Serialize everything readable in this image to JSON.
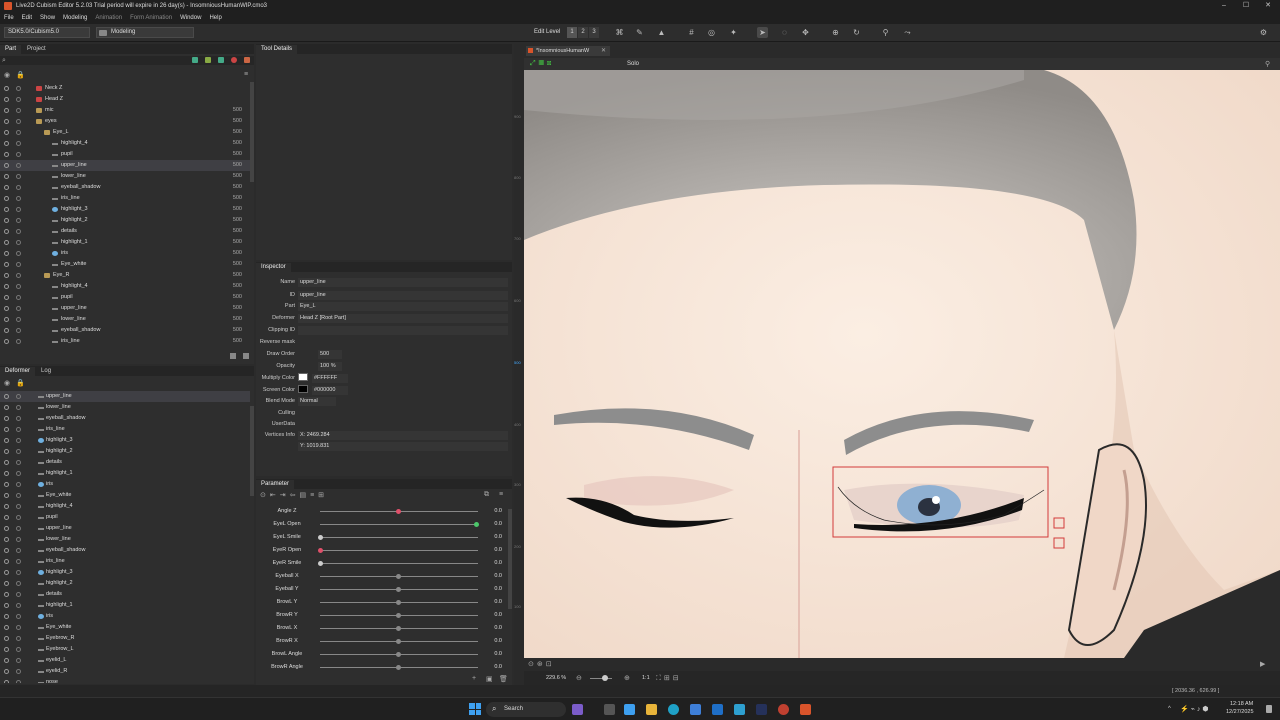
{
  "window": {
    "title": "Live2D Cubism Editor 5.2.03   Trial period will expire in 26 day(s)   - InsomniousHumanWIP.cmo3",
    "controls": [
      "–",
      "☐",
      "✕"
    ]
  },
  "menu": [
    "File",
    "Edit",
    "Show",
    "Modeling",
    "Animation",
    "Form Animation",
    "Window",
    "Help"
  ],
  "toolbar": {
    "sdk_select": "SDK5.0/Cubism5.0",
    "mode_select": "Modeling",
    "edit_level_label": "Edit Level",
    "edit_levels": [
      "1",
      "2",
      "3"
    ]
  },
  "part_panel": {
    "tabs": [
      "Part",
      "Project"
    ],
    "rows": [
      {
        "label": "Neck Z",
        "value": "",
        "indent": 1,
        "icon": "red"
      },
      {
        "label": "Head Z",
        "value": "",
        "indent": 1,
        "icon": "red"
      },
      {
        "label": "mic",
        "value": "500",
        "indent": 1,
        "icon": "folder"
      },
      {
        "label": "eyes",
        "value": "500",
        "indent": 1,
        "icon": "folder"
      },
      {
        "label": "Eye_L",
        "value": "500",
        "indent": 2,
        "icon": "folder"
      },
      {
        "label": "highlight_4",
        "value": "500",
        "indent": 3,
        "icon": "mesh"
      },
      {
        "label": "pupil",
        "value": "500",
        "indent": 3,
        "icon": "mesh"
      },
      {
        "label": "upper_line",
        "value": "500",
        "indent": 3,
        "icon": "mesh",
        "selected": true
      },
      {
        "label": "lower_line",
        "value": "500",
        "indent": 3,
        "icon": "mesh"
      },
      {
        "label": "eyeball_shadow",
        "value": "500",
        "indent": 3,
        "icon": "mesh"
      },
      {
        "label": "iris_line",
        "value": "500",
        "indent": 3,
        "icon": "mesh"
      },
      {
        "label": "highlight_3",
        "value": "500",
        "indent": 3,
        "icon": "img"
      },
      {
        "label": "highlight_2",
        "value": "500",
        "indent": 3,
        "icon": "mesh"
      },
      {
        "label": "details",
        "value": "500",
        "indent": 3,
        "icon": "mesh"
      },
      {
        "label": "highlight_1",
        "value": "500",
        "indent": 3,
        "icon": "mesh"
      },
      {
        "label": "iris",
        "value": "500",
        "indent": 3,
        "icon": "img"
      },
      {
        "label": "Eye_white",
        "value": "500",
        "indent": 3,
        "icon": "mesh"
      },
      {
        "label": "Eye_R",
        "value": "500",
        "indent": 2,
        "icon": "folder"
      },
      {
        "label": "highlight_4",
        "value": "500",
        "indent": 3,
        "icon": "mesh"
      },
      {
        "label": "pupil",
        "value": "500",
        "indent": 3,
        "icon": "mesh"
      },
      {
        "label": "upper_line",
        "value": "500",
        "indent": 3,
        "icon": "mesh"
      },
      {
        "label": "lower_line",
        "value": "500",
        "indent": 3,
        "icon": "mesh"
      },
      {
        "label": "eyeball_shadow",
        "value": "500",
        "indent": 3,
        "icon": "mesh"
      },
      {
        "label": "iris_line",
        "value": "500",
        "indent": 3,
        "icon": "mesh"
      }
    ]
  },
  "deformer_panel": {
    "tabs": [
      "Deformer",
      "Log"
    ],
    "rows": [
      {
        "label": "upper_line",
        "icon": "mesh",
        "selected": true
      },
      {
        "label": "lower_line",
        "icon": "mesh"
      },
      {
        "label": "eyeball_shadow",
        "icon": "mesh"
      },
      {
        "label": "iris_line",
        "icon": "mesh"
      },
      {
        "label": "highlight_3",
        "icon": "img"
      },
      {
        "label": "highlight_2",
        "icon": "mesh"
      },
      {
        "label": "details",
        "icon": "mesh"
      },
      {
        "label": "highlight_1",
        "icon": "mesh"
      },
      {
        "label": "iris",
        "icon": "img"
      },
      {
        "label": "Eye_white",
        "icon": "mesh"
      },
      {
        "label": "highlight_4",
        "icon": "mesh"
      },
      {
        "label": "pupil",
        "icon": "mesh"
      },
      {
        "label": "upper_line",
        "icon": "mesh"
      },
      {
        "label": "lower_line",
        "icon": "mesh"
      },
      {
        "label": "eyeball_shadow",
        "icon": "mesh"
      },
      {
        "label": "iris_line",
        "icon": "mesh"
      },
      {
        "label": "highlight_3",
        "icon": "img"
      },
      {
        "label": "highlight_2",
        "icon": "mesh"
      },
      {
        "label": "details",
        "icon": "mesh"
      },
      {
        "label": "highlight_1",
        "icon": "mesh"
      },
      {
        "label": "iris",
        "icon": "img"
      },
      {
        "label": "Eye_white",
        "icon": "mesh"
      },
      {
        "label": "Eyebrow_R",
        "icon": "mesh"
      },
      {
        "label": "Eyebrow_L",
        "icon": "mesh"
      },
      {
        "label": "eyelid_L",
        "icon": "mesh"
      },
      {
        "label": "eyelid_R",
        "icon": "mesh"
      },
      {
        "label": "nose",
        "icon": "mesh"
      }
    ]
  },
  "tool_details": {
    "title": "Tool Details"
  },
  "inspector": {
    "title": "Inspector",
    "fields": [
      {
        "key": "Name",
        "value": "upper_line"
      },
      {
        "key": "ID",
        "value": "upper_line"
      },
      {
        "key": "Part",
        "value": "Eye_L"
      },
      {
        "key": "Deformer",
        "value": "Head Z  [Root Part]"
      },
      {
        "key": "Clipping ID",
        "value": ""
      },
      {
        "key": "Reverse mask",
        "value": ""
      },
      {
        "key": "Draw Order",
        "value": "500"
      },
      {
        "key": "Opacity",
        "value": "100 %"
      },
      {
        "key": "Multiply Color",
        "value": "#FFFFFF"
      },
      {
        "key": "Screen Color",
        "value": "#000000"
      },
      {
        "key": "Blend Mode",
        "value": "Normal"
      },
      {
        "key": "Culling",
        "value": ""
      },
      {
        "key": "UserData",
        "value": ""
      },
      {
        "key": "Vertices Info",
        "value": "X: 2469.284"
      },
      {
        "key": "",
        "value": "Y: 1019.831"
      }
    ]
  },
  "parameter": {
    "title": "Parameter",
    "rows": [
      {
        "label": "Angle Z",
        "value": "0.0",
        "position": 0.5,
        "color": "#e0506a"
      },
      {
        "label": "EyeL Open",
        "value": "0.0",
        "position": 1.0,
        "color": "#4cc76b"
      },
      {
        "label": "EyeL Smile",
        "value": "0.0",
        "position": 0.0,
        "color": "#cccccc"
      },
      {
        "label": "EyeR Open",
        "value": "0.0",
        "position": 0.0,
        "color": "#e0506a"
      },
      {
        "label": "EyeR Smile",
        "value": "0.0",
        "position": 0.0,
        "color": "#cccccc"
      },
      {
        "label": "Eyeball X",
        "value": "0.0",
        "position": 0.5,
        "color": "#888888"
      },
      {
        "label": "Eyeball Y",
        "value": "0.0",
        "position": 0.5,
        "color": "#888888"
      },
      {
        "label": "BrowL Y",
        "value": "0.0",
        "position": 0.5,
        "color": "#888888"
      },
      {
        "label": "BrowR Y",
        "value": "0.0",
        "position": 0.5,
        "color": "#888888"
      },
      {
        "label": "BrowL X",
        "value": "0.0",
        "position": 0.5,
        "color": "#888888"
      },
      {
        "label": "BrowR X",
        "value": "0.0",
        "position": 0.5,
        "color": "#888888"
      },
      {
        "label": "BrowL Angle",
        "value": "0.0",
        "position": 0.5,
        "color": "#888888"
      },
      {
        "label": "BrowR Angle",
        "value": "0.0",
        "position": 0.5,
        "color": "#888888"
      }
    ]
  },
  "canvas": {
    "tab_label": "*InsomniousHumanW",
    "solo_label": "Solo",
    "ruler_ticks": [
      "900",
      "800",
      "700",
      "600",
      "500",
      "400",
      "300",
      "200",
      "100"
    ],
    "zoom": "229.6 %",
    "ratio": "1:1",
    "cursor_coords": "[ 2036.36 , 626.99 ]"
  },
  "taskbar": {
    "search_label": "Search",
    "time": "12:18 AM",
    "date": "12/27/2025"
  }
}
